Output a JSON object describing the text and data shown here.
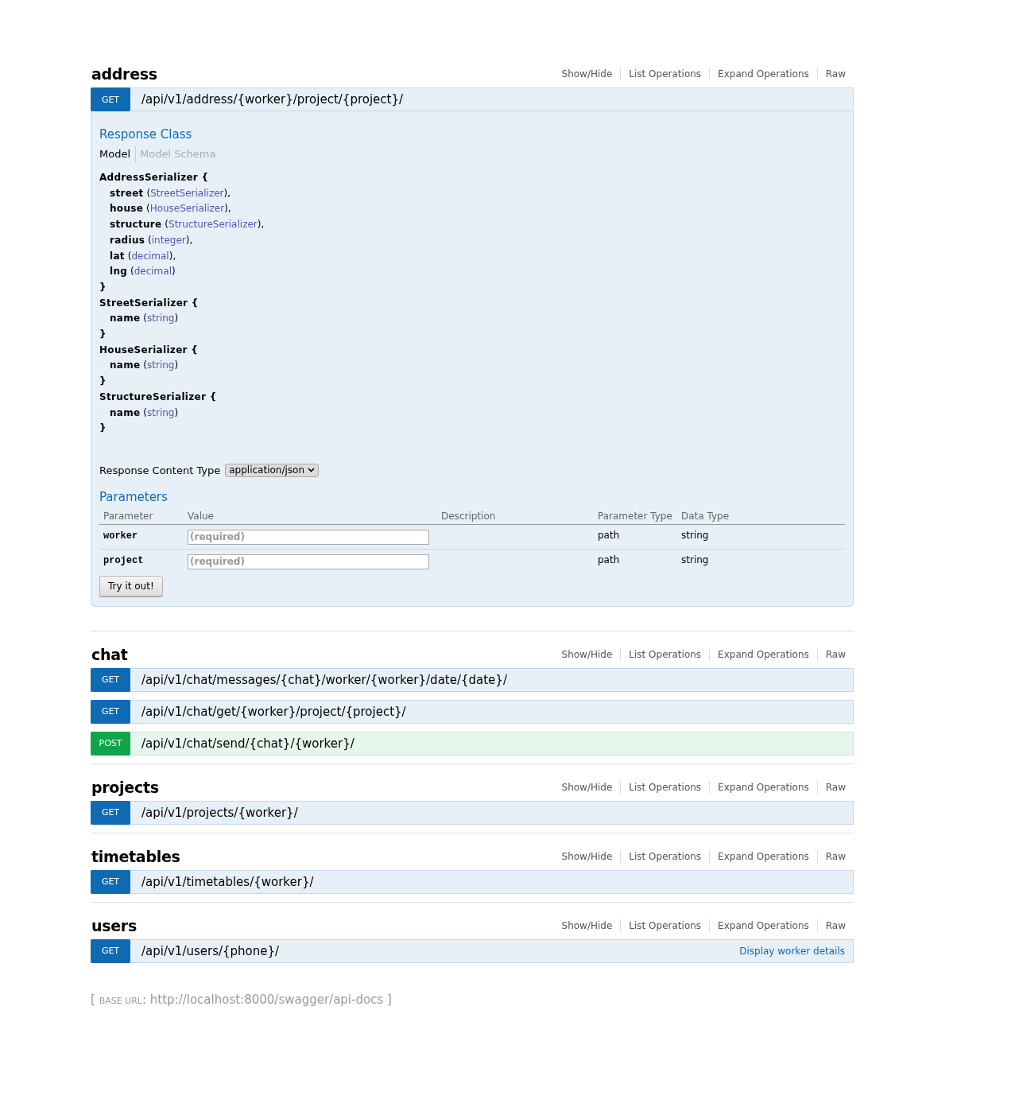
{
  "sections": [
    {
      "name": "address",
      "actions": [
        "Show/Hide",
        "List Operations",
        "Expand Operations",
        "Raw"
      ],
      "operations": [
        {
          "method": "GET",
          "kind": "get",
          "path": "/api/v1/address/{worker}/project/{project}/",
          "expanded": true,
          "details": {
            "response_class_title": "Response Class",
            "model_tabs": [
              {
                "label": "Model",
                "selected": true
              },
              {
                "label": "Model Schema",
                "selected": false
              }
            ],
            "models": [
              {
                "header": "AddressSerializer {",
                "close": "}",
                "fields": [
                  {
                    "name": "street",
                    "lp": "(",
                    "type": "StreetSerializer",
                    "rp": ")",
                    "sep": ","
                  },
                  {
                    "name": "house",
                    "lp": "(",
                    "type": "HouseSerializer",
                    "rp": ")",
                    "sep": ","
                  },
                  {
                    "name": "structure",
                    "lp": "(",
                    "type": "StructureSerializer",
                    "rp": ")",
                    "sep": ","
                  },
                  {
                    "name": "radius",
                    "lp": "(",
                    "type": "integer",
                    "rp": ")",
                    "sep": ","
                  },
                  {
                    "name": "lat",
                    "lp": "(",
                    "type": "decimal",
                    "rp": ")",
                    "sep": ","
                  },
                  {
                    "name": "lng",
                    "lp": "(",
                    "type": "decimal",
                    "rp": ")"
                  }
                ]
              },
              {
                "header": "StreetSerializer {",
                "close": "}",
                "fields": [
                  {
                    "name": "name",
                    "lp": "(",
                    "type": "string",
                    "rp": ")"
                  }
                ]
              },
              {
                "header": "HouseSerializer {",
                "close": "}",
                "fields": [
                  {
                    "name": "name",
                    "lp": "(",
                    "type": "string",
                    "rp": ")"
                  }
                ]
              },
              {
                "header": "StructureSerializer {",
                "close": "}",
                "fields": [
                  {
                    "name": "name",
                    "lp": "(",
                    "type": "string",
                    "rp": ")"
                  }
                ]
              }
            ],
            "content_type_label": "Response Content Type",
            "content_type": "application/json",
            "parameters_title": "Parameters",
            "columns": [
              "Parameter",
              "Value",
              "Description",
              "Parameter Type",
              "Data Type"
            ],
            "parameters": [
              {
                "name": "worker",
                "placeholder": "(required)",
                "param_type": "path",
                "data_type": "string"
              },
              {
                "name": "project",
                "placeholder": "(required)",
                "param_type": "path",
                "data_type": "string"
              }
            ],
            "submit": "Try it out!"
          }
        }
      ]
    },
    {
      "name": "chat",
      "actions": [
        "Show/Hide",
        "List Operations",
        "Expand Operations",
        "Raw"
      ],
      "operations": [
        {
          "method": "GET",
          "kind": "get",
          "path": "/api/v1/chat/messages/{chat}/worker/{worker}/date/{date}/",
          "expanded": false
        },
        {
          "method": "GET",
          "kind": "get",
          "path": "/api/v1/chat/get/{worker}/project/{project}/",
          "expanded": false
        },
        {
          "method": "POST",
          "kind": "post",
          "path": "/api/v1/chat/send/{chat}/{worker}/",
          "expanded": false
        }
      ]
    },
    {
      "name": "projects",
      "actions": [
        "Show/Hide",
        "List Operations",
        "Expand Operations",
        "Raw"
      ],
      "operations": [
        {
          "method": "GET",
          "kind": "get",
          "path": "/api/v1/projects/{worker}/",
          "expanded": false
        }
      ]
    },
    {
      "name": "timetables",
      "actions": [
        "Show/Hide",
        "List Operations",
        "Expand Operations",
        "Raw"
      ],
      "operations": [
        {
          "method": "GET",
          "kind": "get",
          "path": "/api/v1/timetables/{worker}/",
          "expanded": false
        }
      ]
    },
    {
      "name": "users",
      "actions": [
        "Show/Hide",
        "List Operations",
        "Expand Operations",
        "Raw"
      ],
      "operations": [
        {
          "method": "GET",
          "kind": "get",
          "path": "/api/v1/users/{phone}/",
          "summary": "Display worker details",
          "expanded": false
        }
      ]
    }
  ],
  "footer": {
    "open": "[",
    "label": "BASE URL",
    "colon": ":",
    "url": "http://localhost:8000/swagger/api-docs",
    "close": "]"
  }
}
